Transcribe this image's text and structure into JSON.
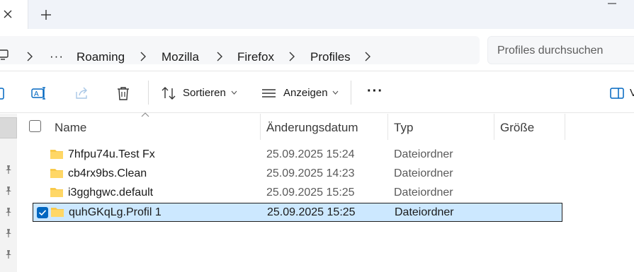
{
  "breadcrumb": {
    "overflow_label": "···",
    "items": [
      "Roaming",
      "Mozilla",
      "Firefox",
      "Profiles"
    ]
  },
  "search": {
    "placeholder": "Profiles durchsuchen"
  },
  "toolbar": {
    "sort_label": "Sortieren",
    "view_label": "Anzeigen",
    "more_label": "···",
    "details_label": "V"
  },
  "columns": {
    "name": "Name",
    "date": "Änderungsdatum",
    "type": "Typ",
    "size": "Größe"
  },
  "files": [
    {
      "name": "7hfpu74u.Test Fx",
      "date": "25.09.2025 15:24",
      "type": "Dateiordner",
      "selected": false
    },
    {
      "name": "cb4rx9bs.Clean",
      "date": "25.09.2025 14:23",
      "type": "Dateiordner",
      "selected": false
    },
    {
      "name": "i3gghgwc.default",
      "date": "25.09.2025 15:25",
      "type": "Dateiordner",
      "selected": false
    },
    {
      "name": "quhGKqLg.Profil 1",
      "date": "25.09.2025 15:25",
      "type": "Dateiordner",
      "selected": true
    }
  ],
  "icons": {
    "tab_close": "close-icon",
    "new_tab": "plus-icon",
    "computer": "computer-icon",
    "rename": "rename-icon",
    "share": "share-icon",
    "delete": "trash-icon",
    "sort": "sort-arrows-icon",
    "view": "view-lines-icon",
    "details": "details-pane-icon",
    "pin": "pin-icon",
    "folder": "folder-icon"
  },
  "colors": {
    "accent": "#0067c0",
    "selection_bg": "#cce8ff",
    "folder": "#f8c94a"
  }
}
